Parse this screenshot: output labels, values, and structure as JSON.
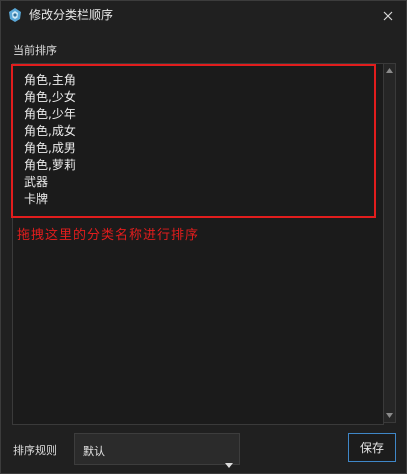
{
  "window": {
    "title": "修改分类栏顺序",
    "icons": {
      "app": "app-logo-icon",
      "close": "close-icon"
    }
  },
  "section_label": "当前排序",
  "categories": [
    "角色,主角",
    "角色,少女",
    "角色,少年",
    "角色,成女",
    "角色,成男",
    "角色,萝莉",
    "武器",
    "卡牌"
  ],
  "annotation": {
    "hint": "拖拽这里的分类名称进行排序",
    "color": "#e21d1d"
  },
  "footer": {
    "rule_label": "排序规则",
    "rule_value": "默认",
    "save_label": "保存",
    "accent": "#3f87c8"
  }
}
